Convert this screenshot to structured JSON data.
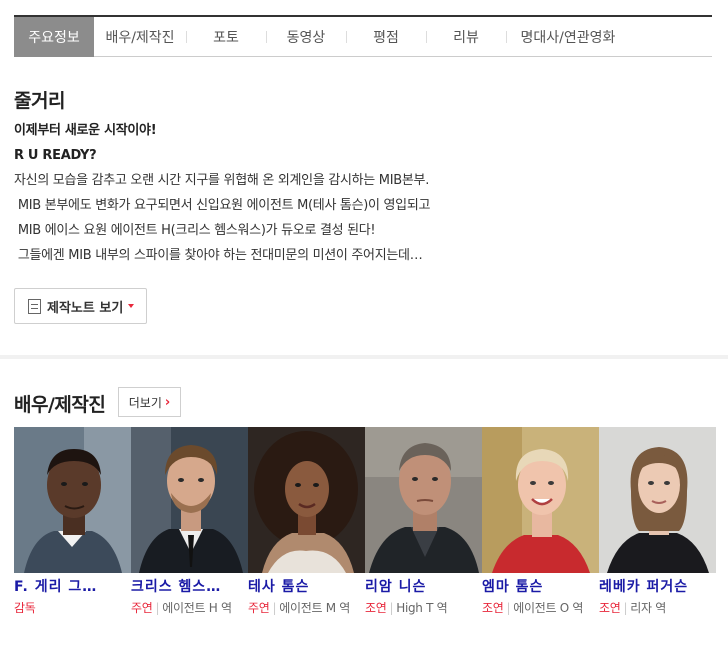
{
  "tabs": [
    {
      "label": "주요정보",
      "active": true
    },
    {
      "label": "배우/제작진"
    },
    {
      "label": "포토"
    },
    {
      "label": "동영상"
    },
    {
      "label": "평점"
    },
    {
      "label": "리뷰"
    },
    {
      "label": "명대사/연관영화"
    }
  ],
  "synopsis": {
    "title": "줄거리",
    "lines": [
      "이제부터 새로운 시작이야!",
      "R U READY?",
      "자신의 모습을 감추고 오랜 시간 지구를 위협해 온 외계인을 감시하는 MIB본부.",
      " MIB 본부에도 변화가 요구되면서 신입요원 에이전트 M(테사 톰슨)이 영입되고",
      " MIB 에이스 요원 에이전트 H(크리스 헴스워스)가 듀오로 결성 된다!",
      " 그들에겐 MIB 내부의 스파이를 찾아야 하는 전대미문의 미션이 주어지는데…"
    ],
    "note_button": "제작노트 보기"
  },
  "cast_section": {
    "title": "배우/제작진",
    "more_button": "더보기"
  },
  "cast": [
    {
      "name": "F. 게리 그…",
      "kind": "감독",
      "role": ""
    },
    {
      "name": "크리스 헴스…",
      "kind": "주연",
      "role": "에이전트 H 역"
    },
    {
      "name": "테사 톰슨",
      "kind": "주연",
      "role": "에이전트 M 역"
    },
    {
      "name": "리암 니슨",
      "kind": "조연",
      "role": "High T 역"
    },
    {
      "name": "엠마 톰슨",
      "kind": "조연",
      "role": "에이전트 O 역"
    },
    {
      "name": "레베카 퍼거슨",
      "kind": "조연",
      "role": "리자 역"
    }
  ],
  "colors": {
    "accent": "#e8283c",
    "name_link": "#1a1aa6",
    "active_tab": "#8c8c8c"
  }
}
